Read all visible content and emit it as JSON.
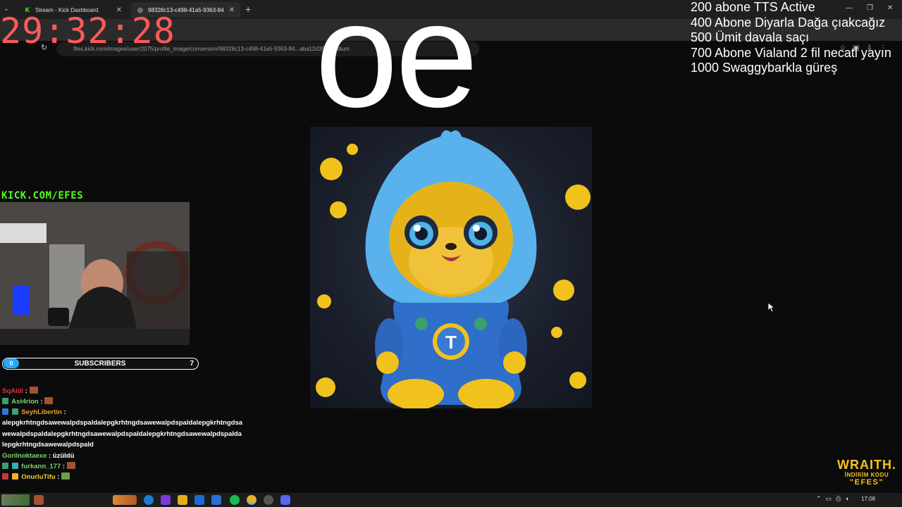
{
  "browser": {
    "tabs": [
      {
        "title": "Stream - Kick Dashboard",
        "active": false
      },
      {
        "title": "98328c13-c498-41a5-9363-84",
        "active": true
      }
    ],
    "new_tab": "+",
    "url": "files.kick.com/images/user/2075/profile_image/conversion/98328c13-c498-41a5-9363-84...aba12d35c-medium"
  },
  "overlay": {
    "timer": "29:32:28",
    "big_text": "oe",
    "goals": [
      "200 abone TTS Active",
      "400 Abone Diyarla Dağa çıakcağız",
      "500 Ümit davala saçı",
      "700 Abone Vialand 2 fil necati yayın",
      "1000 Swaggybarkla güreş"
    ],
    "kick_handle": "KICK.COM/EFES"
  },
  "subscribers": {
    "current": "0",
    "label": "SUBSCRIBERS",
    "goal": "7"
  },
  "chat": [
    {
      "user": "SqAldi",
      "text": ":",
      "user_color": "#e0323a",
      "emote": true
    },
    {
      "user": "Ast4rion",
      "text": ":",
      "user_color": "#7bd66a",
      "emote": true
    },
    {
      "user": "SeyhLibertin",
      "text": ":",
      "user_color": "#f0a030",
      "emote": false
    },
    {
      "user": "",
      "text": "alepgkrhtngdsawewalpdspaldalepgkrhtngdsawewalpdspaldalepgkrhtngdsawewalpdspaldalepgkrhtngdsawewalpdspaldalepgkrhtngdsawewalpdspaldalepgkrhtngdsawewalpdspald",
      "user_color": "#fff",
      "emote": false
    },
    {
      "user": "Gorilnoktaexe",
      "text": ": üzüldü",
      "user_color": "#7bd66a",
      "emote": false
    },
    {
      "user": "furkann_177",
      "text": ":",
      "user_color": "#7bd66a",
      "emote": true
    },
    {
      "user": "OnurluTifu",
      "text": ":",
      "user_color": "#f0d030",
      "emote": true
    }
  ],
  "sponsor": {
    "brand": "WRAITH.",
    "code_label": "İNDİRİM KODU",
    "code": "\"EFES\""
  },
  "taskbar": {
    "clock": "17:08"
  },
  "colors": {
    "timer": "#ff5a5a",
    "kick_green": "#53fc18",
    "sub_accent": "#20a8ff",
    "sponsor": "#f6c21a"
  }
}
